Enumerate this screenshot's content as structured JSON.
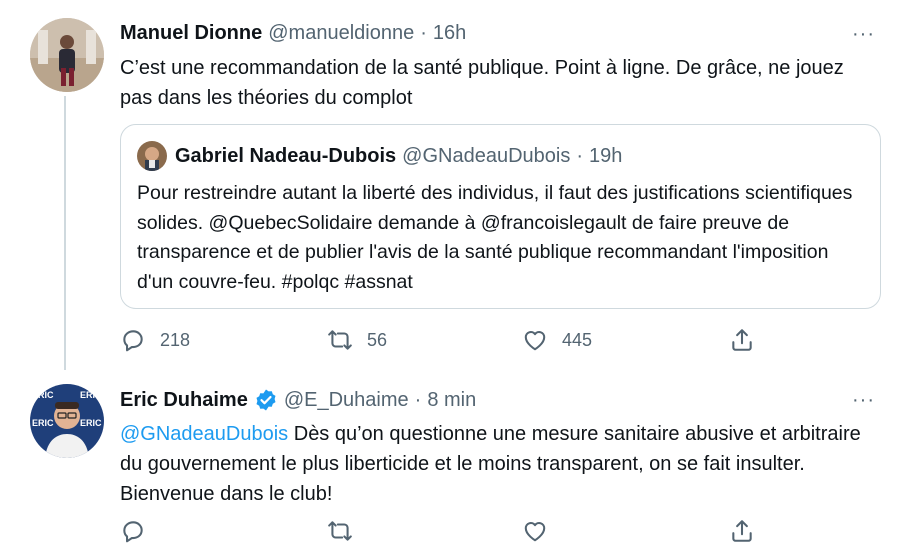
{
  "tweet1": {
    "name": "Manuel Dionne",
    "handle": "@manueldionne",
    "sep": "·",
    "time": "16h",
    "more": "···",
    "text": "C’est une recommandation de la santé publique. Point à ligne. De grâce, ne jouez pas dans les théories du complot",
    "quote": {
      "name": "Gabriel Nadeau-Dubois",
      "handle": "@GNadeauDubois",
      "sep": "·",
      "time": "19h",
      "text": "Pour restreindre autant la liberté des individus, il faut des justifications scientifiques solides. @QuebecSolidaire demande à @francoislegault de faire preuve de transparence et de publier l'avis de la santé publique recommandant l'imposition d'un couvre-feu. #polqc #assnat"
    },
    "actions": {
      "replies": "218",
      "retweets": "56",
      "likes": "445"
    }
  },
  "tweet2": {
    "name": "Eric Duhaime",
    "handle": "@E_Duhaime",
    "sep": "·",
    "time": "8 min",
    "more": "···",
    "mention": "@GNadeauDubois",
    "text": " Dès qu’on questionne une mesure sanitaire abusive et arbitraire du gouvernement le plus liberticide et le moins transparent, on se fait insulter. Bienvenue dans le club!",
    "avatar_banner_text": "ERIC",
    "actions": {
      "replies": "",
      "retweets": "",
      "likes": ""
    }
  },
  "colors": {
    "link": "#1d9bf0",
    "secondary": "#536471",
    "border": "#cfd9de",
    "verified": "#1d9bf0"
  }
}
